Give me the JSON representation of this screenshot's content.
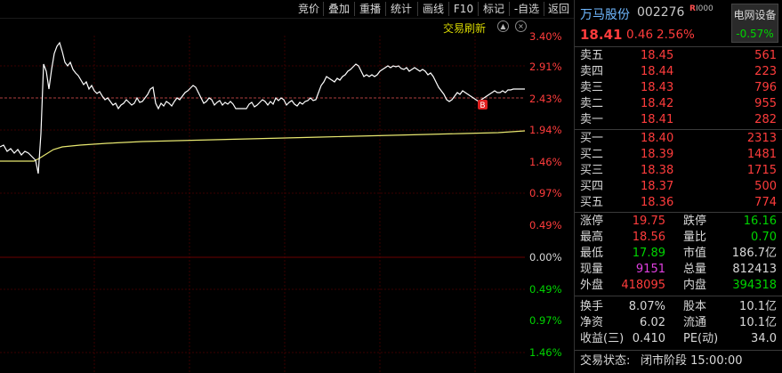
{
  "toolbar": {
    "buttons": [
      "竞价",
      "叠加",
      "重播",
      "统计",
      "画线",
      "F10",
      "标记",
      "-自选",
      "返回"
    ]
  },
  "subbar": {
    "refresh_label": "交易刷新",
    "up_btn": "▲",
    "close_btn": "×"
  },
  "axis": {
    "labels": [
      "3.40%",
      "2.91%",
      "2.43%",
      "1.94%",
      "1.46%",
      "0.97%",
      "0.49%",
      "0.00%",
      "0.49%",
      "0.97%",
      "1.46%"
    ],
    "colors": [
      "#ff3c3c",
      "#ff3c3c",
      "#ff3c3c",
      "#ff3c3c",
      "#ff3c3c",
      "#ff3c3c",
      "#ff3c3c",
      "#d8d8d8",
      "#00d400",
      "#00d400",
      "#00d400"
    ]
  },
  "chart": {
    "buy_marker": "B",
    "prev_close_pct": 2.56,
    "price_line_color": "#ffffff",
    "avg_line_color": "#e8e870"
  },
  "stock": {
    "name": "万马股份",
    "code": "002276",
    "badge": "R",
    "badge2": "I000",
    "price": "18.41",
    "change": "0.46",
    "change_pct": "2.56%",
    "sector_name": "电网设备",
    "sector_pct": "-0.57%"
  },
  "order_book": {
    "asks": [
      {
        "label": "卖五",
        "price": "18.45",
        "vol": "561"
      },
      {
        "label": "卖四",
        "price": "18.44",
        "vol": "223"
      },
      {
        "label": "卖三",
        "price": "18.43",
        "vol": "796"
      },
      {
        "label": "卖二",
        "price": "18.42",
        "vol": "955"
      },
      {
        "label": "卖一",
        "price": "18.41",
        "vol": "282"
      }
    ],
    "bids": [
      {
        "label": "买一",
        "price": "18.40",
        "vol": "2313"
      },
      {
        "label": "买二",
        "price": "18.39",
        "vol": "1481"
      },
      {
        "label": "买三",
        "price": "18.38",
        "vol": "1715"
      },
      {
        "label": "买四",
        "price": "18.37",
        "vol": "500"
      },
      {
        "label": "买五",
        "price": "18.36",
        "vol": "774"
      }
    ]
  },
  "stats": {
    "limit_up_label": "涨停",
    "limit_up": "19.75",
    "limit_down_label": "跌停",
    "limit_down": "16.16",
    "high_label": "最高",
    "high": "18.56",
    "vol_ratio_label": "量比",
    "vol_ratio": "0.70",
    "low_label": "最低",
    "low": "17.89",
    "mktcap_label": "市值",
    "mktcap": "186.7亿",
    "cur_vol_label": "现量",
    "cur_vol": "9151",
    "total_vol_label": "总量",
    "total_vol": "812413",
    "outer_label": "外盘",
    "outer": "418095",
    "inner_label": "内盘",
    "inner": "394318",
    "turnover_label": "换手",
    "turnover": "8.07%",
    "shares_label": "股本",
    "shares": "10.1亿",
    "nav_label": "净资",
    "nav": "6.02",
    "float_label": "流通",
    "float": "10.1亿",
    "eps_label": "收益(三)",
    "eps": "0.410",
    "pe_label": "PE(动)",
    "pe": "34.0",
    "status_label": "交易状态:",
    "status": "闭市阶段 15:00:00"
  }
}
